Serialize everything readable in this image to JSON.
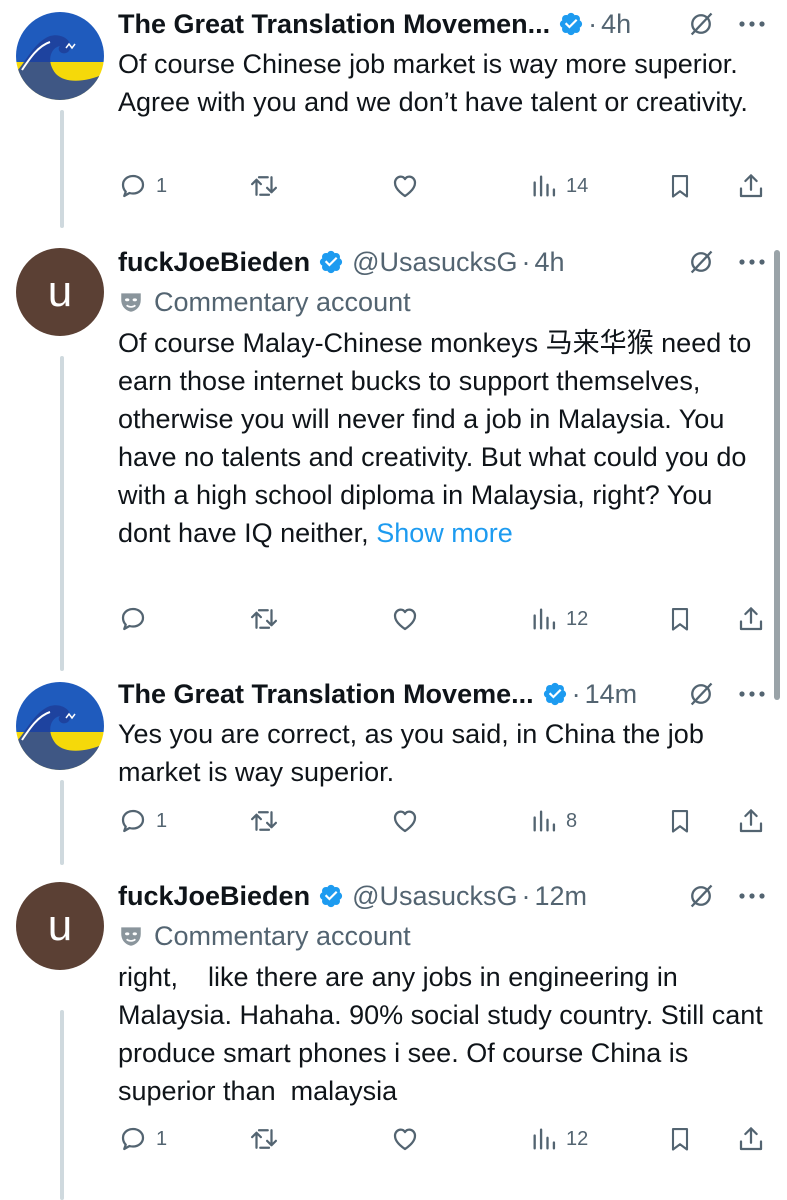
{
  "colors": {
    "accent": "#1d9bf0",
    "muted": "#536471",
    "text": "#0f1419",
    "avatar_u_bg": "#5b4034"
  },
  "icons": [
    "verified-badge-icon",
    "grok-icon",
    "more-icon",
    "reply-icon",
    "retweet-icon",
    "like-icon",
    "views-icon",
    "bookmark-icon",
    "share-icon",
    "commentary-mask-icon"
  ],
  "tweets": [
    {
      "name": "The Great Translation Movemen...",
      "time": "4h",
      "body": "Of course Chinese job market is way more superior. Agree with you and we don’t have talent or creativity.",
      "replies": "1",
      "views": "14"
    },
    {
      "avatar_letter": "u",
      "name": "fuckJoeBieden",
      "handle": "@UsasucksG",
      "time": "4h",
      "label": "Commentary account",
      "body": "Of course Malay-Chinese monkeys 马来华猴 need to earn those internet bucks to support themselves, otherwise you will never find a job in Malaysia. You have no talents and creativity. But what could you do with a high school diploma in Malaysia, right? You dont have IQ  neither, ",
      "show_more": "Show more",
      "replies": "",
      "views": "12"
    },
    {
      "name": "The Great Translation Moveme...",
      "time": "14m",
      "body": "Yes you are correct, as you said, in China the job market is way superior.",
      "replies": "1",
      "views": "8"
    },
    {
      "avatar_letter": "u",
      "name": "fuckJoeBieden",
      "handle": "@UsasucksG",
      "time": "12m",
      "label": "Commentary account",
      "body": "right,    like there are any jobs in engineering in Malaysia. Hahaha. 90% social study country. Still cant produce smart phones i see. Of course China is superior than  malaysia",
      "replies": "1",
      "views": "12"
    }
  ],
  "separator": "·"
}
